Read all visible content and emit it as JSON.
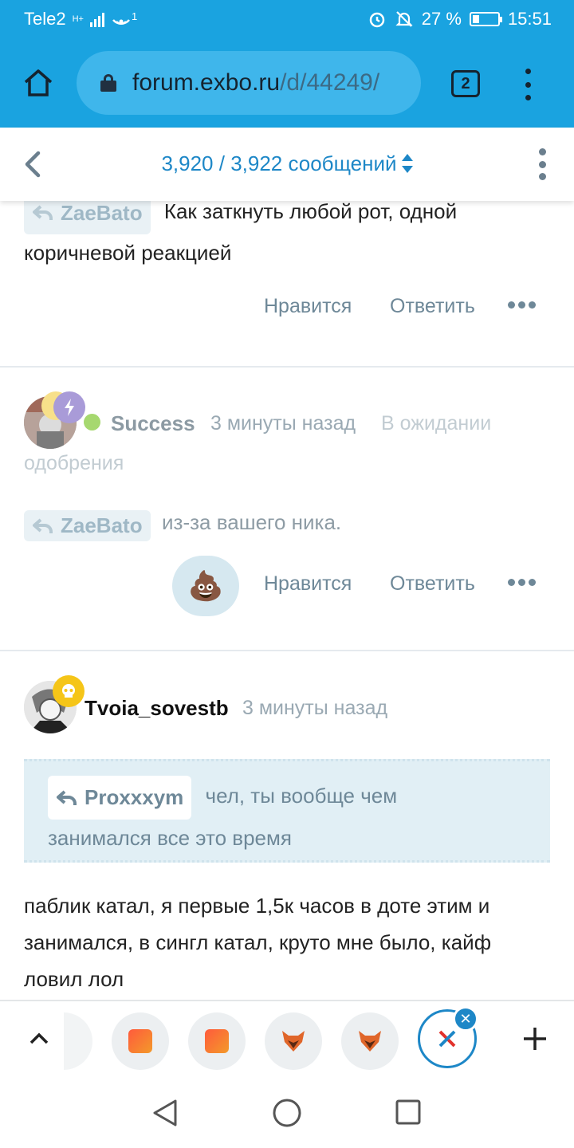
{
  "status_bar": {
    "carrier": "Tele2",
    "network_type": "H+",
    "hotspot_count": "1",
    "battery_percent": "27 %",
    "battery_level": 0.27,
    "time": "15:51"
  },
  "browser": {
    "url_host": "forum.exbo.ru",
    "url_path": "/d/44249/",
    "tab_count": "2"
  },
  "forum_header": {
    "counter": "3,920 / 3,922 сообщений"
  },
  "posts": [
    {
      "reply_to": "ZaeBato",
      "text_first": "Как заткнуть любой рот, одной",
      "text_rest": "коричневой реакцией",
      "like_label": "Нравится",
      "reply_label": "Ответить"
    },
    {
      "author": "Success",
      "time": "3 минуты назад",
      "status": "В ожидании",
      "status_rest": "одобрения",
      "reply_to": "ZaeBato",
      "text": "из-за вашего ника.",
      "reaction": "💩",
      "like_label": "Нравится",
      "reply_label": "Ответить"
    },
    {
      "author": "Tvoia_sovestb",
      "time": "3 минуты назад",
      "quote": {
        "reply_to": "Proxxxym",
        "text_first": "чел, ты вообще чем",
        "text_rest": "занимался все это время"
      },
      "text_lines": [
        "паблик катал, я первые 1,5к часов в доте этим и",
        "занимался, в сингл катал, круто мне было, кайф",
        "ловил лол"
      ]
    }
  ],
  "colors": {
    "browser_bar": "#1aa3e0",
    "link_blue": "#1d87c7",
    "online_dot": "#a6d86f"
  }
}
